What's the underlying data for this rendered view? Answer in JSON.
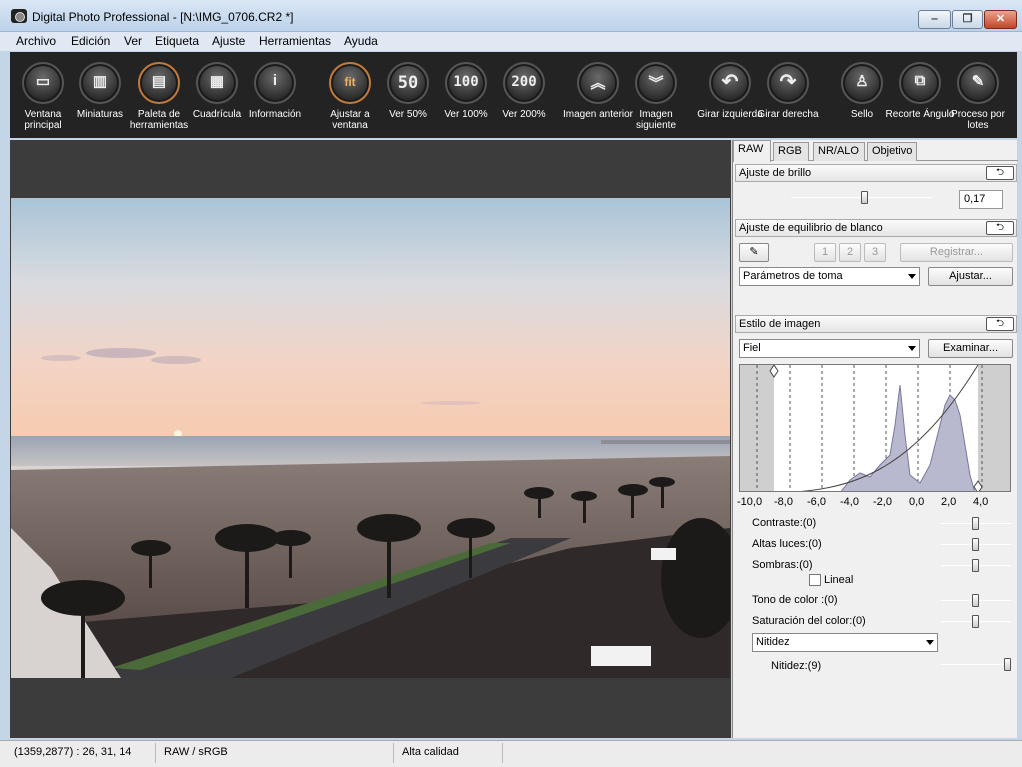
{
  "window": {
    "title": "Digital Photo Professional - [N:\\IMG_0706.CR2 *]",
    "minimize": "‒",
    "maximize": "❐",
    "close": "✕"
  },
  "menu": [
    "Archivo",
    "Edición",
    "Ver",
    "Etiqueta",
    "Ajuste",
    "Herramientas",
    "Ayuda"
  ],
  "toolbar": [
    {
      "label": "Ventana principal",
      "icon": "folder-icon",
      "glyph": "▭"
    },
    {
      "label": "Miniaturas",
      "icon": "thumbnails-icon",
      "glyph": "▥"
    },
    {
      "label": "Paleta de herramientas",
      "icon": "tool-palette-icon",
      "glyph": "▤"
    },
    {
      "label": "Cuadrícula",
      "icon": "grid-icon",
      "glyph": "▦"
    },
    {
      "label": "Información",
      "icon": "info-icon",
      "glyph": "i"
    },
    {
      "label": "Ajustar a ventana",
      "icon": "fit-icon",
      "glyph": "fit"
    },
    {
      "label": "Ver 50%",
      "icon": "zoom-50-icon",
      "glyph": "50"
    },
    {
      "label": "Ver 100%",
      "icon": "zoom-100-icon",
      "glyph": "100"
    },
    {
      "label": "Ver 200%",
      "icon": "zoom-200-icon",
      "glyph": "200"
    },
    {
      "label": "Imagen anterior",
      "icon": "previous-image-icon",
      "glyph": "︽"
    },
    {
      "label": "Imagen siguiente",
      "icon": "next-image-icon",
      "glyph": "︾"
    },
    {
      "label": "Girar izquierda",
      "icon": "rotate-left-icon",
      "glyph": "↶"
    },
    {
      "label": "Girar derecha",
      "icon": "rotate-right-icon",
      "glyph": "↷"
    },
    {
      "label": "Sello",
      "icon": "stamp-icon",
      "glyph": "♙"
    },
    {
      "label": "Recorte Ángulo",
      "icon": "crop-icon",
      "glyph": "⧉"
    },
    {
      "label": "Proceso por lotes",
      "icon": "batch-process-icon",
      "glyph": "✎"
    }
  ],
  "panel": {
    "tabs": [
      "RAW",
      "RGB",
      "NR/ALO",
      "Objetivo"
    ],
    "brightness": {
      "title": "Ajuste de brillo",
      "value": "0,17",
      "level": 0.52
    },
    "white_balance": {
      "title": "Ajuste de equilibrio de blanco",
      "presets": [
        "1",
        "2",
        "3"
      ],
      "register": "Registrar...",
      "mode": "Parámetros de toma",
      "adjust": "Ajustar..."
    },
    "picture_style": {
      "title": "Estilo de imagen",
      "style": "Fiel",
      "browse": "Examinar...",
      "histogram_ticks": [
        "-10,0",
        "-8,0",
        "-6,0",
        "-4,0",
        "-2,0",
        "0,0",
        "2,0",
        "4,0"
      ],
      "contrast": {
        "label": "Contraste:(0)",
        "level": 0.5
      },
      "highlights": {
        "label": "Altas luces:(0)",
        "level": 0.5
      },
      "shadows": {
        "label": "Sombras:(0)",
        "level": 0.5
      },
      "linear": "Lineal",
      "color_tone": {
        "label": "Tono de color :(0)",
        "level": 0.5
      },
      "saturation": {
        "label": "Saturación del color:(0)",
        "level": 0.5
      },
      "sharpness_mode": "Nitidez",
      "sharpness": {
        "label": "Nitidez:(9)",
        "level": 0.95
      }
    }
  },
  "status": {
    "coords": "(1359,2877) :  26, 31, 14",
    "color": "RAW / sRGB",
    "quality": "Alta calidad"
  }
}
